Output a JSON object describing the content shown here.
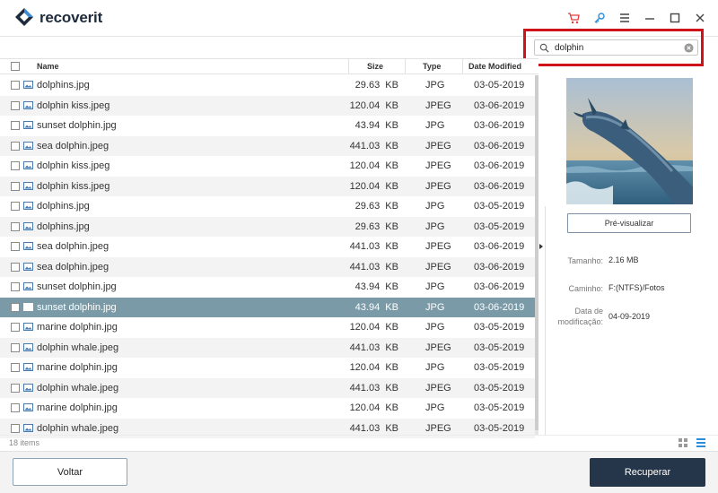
{
  "app": {
    "brand_prefix": "recover",
    "brand_suffix": "it",
    "icons": [
      "cart-icon",
      "key-icon",
      "menu-icon",
      "minimize-icon",
      "maximize-icon",
      "close-icon"
    ]
  },
  "search": {
    "value": "dolphin",
    "placeholder": ""
  },
  "table": {
    "columns": {
      "name": "Name",
      "size": "Size",
      "type": "Type",
      "date": "Date Modified"
    },
    "rows": [
      {
        "name": "dolphins.jpg",
        "size": "29.63  KB",
        "type": "JPG",
        "date": "03-05-2019"
      },
      {
        "name": "dolphin kiss.jpeg",
        "size": "120.04  KB",
        "type": "JPEG",
        "date": "03-06-2019"
      },
      {
        "name": "sunset dolphin.jpg",
        "size": "43.94  KB",
        "type": "JPG",
        "date": "03-06-2019"
      },
      {
        "name": "sea dolphin.jpeg",
        "size": "441.03  KB",
        "type": "JPEG",
        "date": "03-06-2019"
      },
      {
        "name": "dolphin kiss.jpeg",
        "size": "120.04  KB",
        "type": "JPEG",
        "date": "03-06-2019"
      },
      {
        "name": "dolphin kiss.jpeg",
        "size": "120.04  KB",
        "type": "JPEG",
        "date": "03-06-2019"
      },
      {
        "name": "dolphins.jpg",
        "size": "29.63  KB",
        "type": "JPG",
        "date": "03-05-2019"
      },
      {
        "name": "dolphins.jpg",
        "size": "29.63  KB",
        "type": "JPG",
        "date": "03-05-2019"
      },
      {
        "name": "sea dolphin.jpeg",
        "size": "441.03  KB",
        "type": "JPEG",
        "date": "03-06-2019"
      },
      {
        "name": "sea dolphin.jpeg",
        "size": "441.03  KB",
        "type": "JPEG",
        "date": "03-06-2019"
      },
      {
        "name": "sunset dolphin.jpg",
        "size": "43.94  KB",
        "type": "JPG",
        "date": "03-06-2019"
      },
      {
        "name": "sunset dolphin.jpg",
        "size": "43.94  KB",
        "type": "JPG",
        "date": "03-06-2019",
        "selected": true
      },
      {
        "name": "marine dolphin.jpg",
        "size": "120.04  KB",
        "type": "JPG",
        "date": "03-05-2019"
      },
      {
        "name": "dolphin whale.jpeg",
        "size": "441.03  KB",
        "type": "JPEG",
        "date": "03-05-2019"
      },
      {
        "name": "marine dolphin.jpg",
        "size": "120.04  KB",
        "type": "JPG",
        "date": "03-05-2019"
      },
      {
        "name": "dolphin whale.jpeg",
        "size": "441.03  KB",
        "type": "JPEG",
        "date": "03-05-2019"
      },
      {
        "name": "marine dolphin.jpg",
        "size": "120.04  KB",
        "type": "JPG",
        "date": "03-05-2019"
      },
      {
        "name": "dolphin whale.jpeg",
        "size": "441.03  KB",
        "type": "JPEG",
        "date": "03-05-2019"
      }
    ],
    "item_count": "18 items"
  },
  "details": {
    "preview_button": "Pré-visualizar",
    "size_label": "Tamanho:",
    "size_value": "2.16  MB",
    "path_label": "Caminho:",
    "path_value": "F:(NTFS)/Fotos",
    "date_label_line1": "Data de",
    "date_label_line2": "modificação:",
    "date_value": "04-09-2019"
  },
  "footer": {
    "back_label": "Voltar",
    "recover_label": "Recuperar"
  },
  "colors": {
    "selected_row": "#7a9aa8",
    "accent_dark": "#25364a",
    "highlight_red": "#d0121b",
    "icon_red": "#e23b3b",
    "icon_blue": "#2a8fd8"
  }
}
